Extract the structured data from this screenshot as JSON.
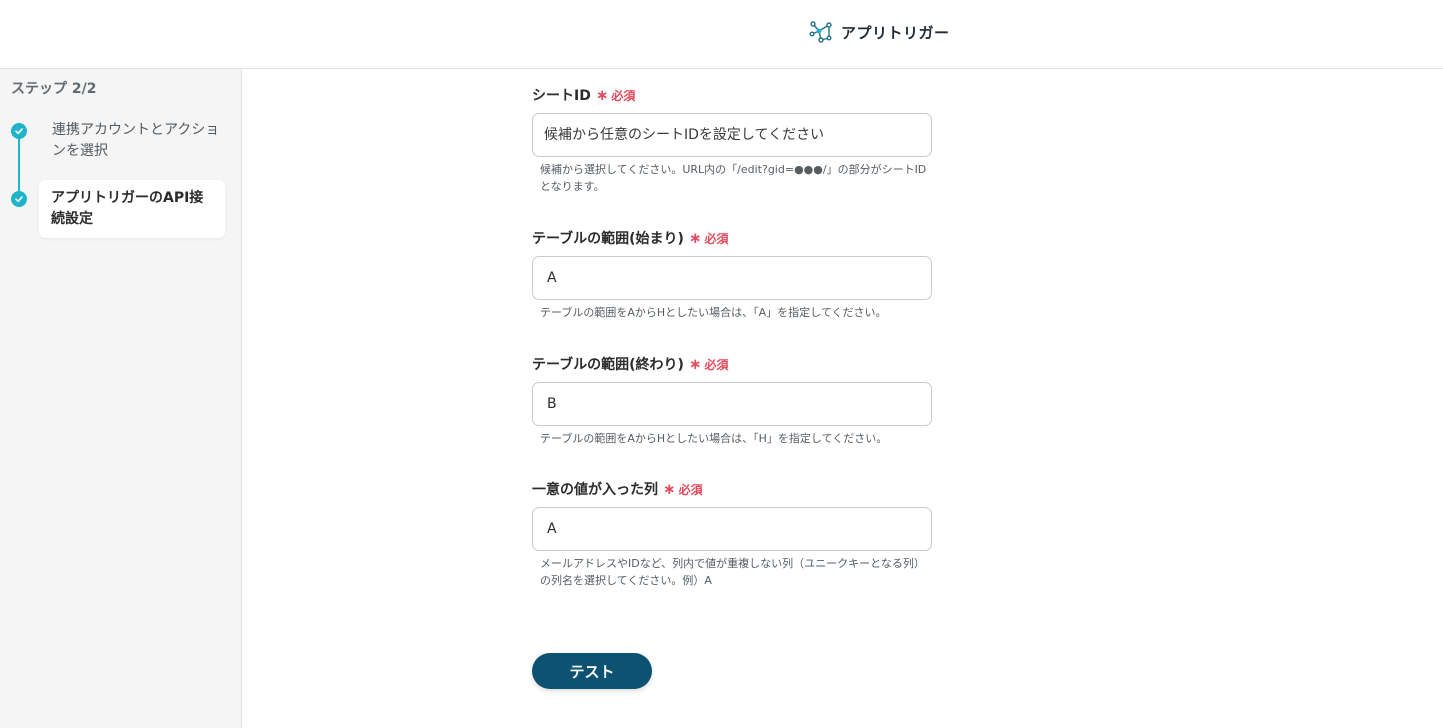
{
  "header": {
    "brand_name": "アプリトリガー",
    "brand_icon": "network-nodes-icon"
  },
  "sidebar": {
    "step_count": "ステップ 2/2",
    "steps": [
      {
        "label": "連携アカウントとアクションを選択",
        "status": "completed",
        "icon": "check-icon"
      },
      {
        "label": "アプリトリガーのAPI接続設定",
        "status": "active",
        "icon": "check-icon"
      }
    ]
  },
  "form": {
    "required_asterisk": "∗",
    "required_text": "必須",
    "fields": [
      {
        "label": "シートID",
        "value": "",
        "placeholder": "候補から任意のシートIDを設定してください",
        "help": "候補から選択してください。URL内の「/edit?gid=●●●/」の部分がシートIDとなります。"
      },
      {
        "label": "テーブルの範囲(始まり)",
        "value": "A",
        "placeholder": "",
        "help": "テーブルの範囲をAからHとしたい場合は、「A」を指定してください。"
      },
      {
        "label": "テーブルの範囲(終わり)",
        "value": "B",
        "placeholder": "",
        "help": "テーブルの範囲をAからHとしたい場合は、「H」を指定してください。"
      },
      {
        "label": "一意の値が入った列",
        "value": "A",
        "placeholder": "",
        "help": "メールアドレスやIDなど、列内で値が重複しない列（ユニークキーとなる列）の列名を選択してください。例）A"
      }
    ],
    "submit_label": "テスト"
  },
  "colors": {
    "accent_teal": "#1fb4c8",
    "button_navy": "#0d5270",
    "required_red": "#e24b5b"
  }
}
